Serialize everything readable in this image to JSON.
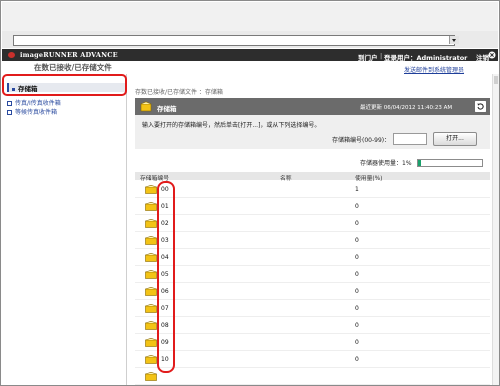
{
  "browser": {
    "address_value": ""
  },
  "header": {
    "brand": "imageRUNNER ADVANCE",
    "links": [
      "到门户",
      "登录用户：Administrator",
      "注销"
    ]
  },
  "subbar": {
    "title": "在数已接收/已存储文件",
    "right_link": "发送邮件到系统管理员"
  },
  "sidebar": {
    "items": [
      {
        "label": "存储箱",
        "active": true
      },
      {
        "label": "传真/I传真收件箱",
        "active": false
      },
      {
        "label": "等候传真收件箱",
        "active": false
      }
    ]
  },
  "main": {
    "breadcrumb": "存数已接收/已存储文件 ：存储箱",
    "panel_title": "存储箱",
    "last_updated": "最近更新  06/04/2012 11:40:23 AM",
    "instruction": "输入要打开的存储箱编号，然后单击[打开...]，或从下列选择编号。",
    "box_number_label": "存储箱编号(00-99)：",
    "box_number_value": "",
    "open_button": "打开...",
    "usage_label": "存储器使用量：1%",
    "usage_fraction": 0.01,
    "columns": [
      "存储箱编号",
      "名称",
      "使用量(%)"
    ],
    "rows": [
      {
        "num": "00",
        "name": "",
        "use": "1"
      },
      {
        "num": "01",
        "name": "",
        "use": "0"
      },
      {
        "num": "02",
        "name": "",
        "use": "0"
      },
      {
        "num": "03",
        "name": "",
        "use": "0"
      },
      {
        "num": "04",
        "name": "",
        "use": "0"
      },
      {
        "num": "05",
        "name": "",
        "use": "0"
      },
      {
        "num": "06",
        "name": "",
        "use": "0"
      },
      {
        "num": "07",
        "name": "",
        "use": "0"
      },
      {
        "num": "08",
        "name": "",
        "use": "0"
      },
      {
        "num": "09",
        "name": "",
        "use": "0"
      },
      {
        "num": "10",
        "name": "",
        "use": "0"
      },
      {
        "num": "",
        "name": "",
        "use": ""
      }
    ]
  },
  "colors": {
    "header_bg": "#2d2d2d",
    "panel_bg": "#6b6b6b",
    "link": "#1f3f9a",
    "highlight": "#e11b1b",
    "usage": "#1aa06b"
  }
}
